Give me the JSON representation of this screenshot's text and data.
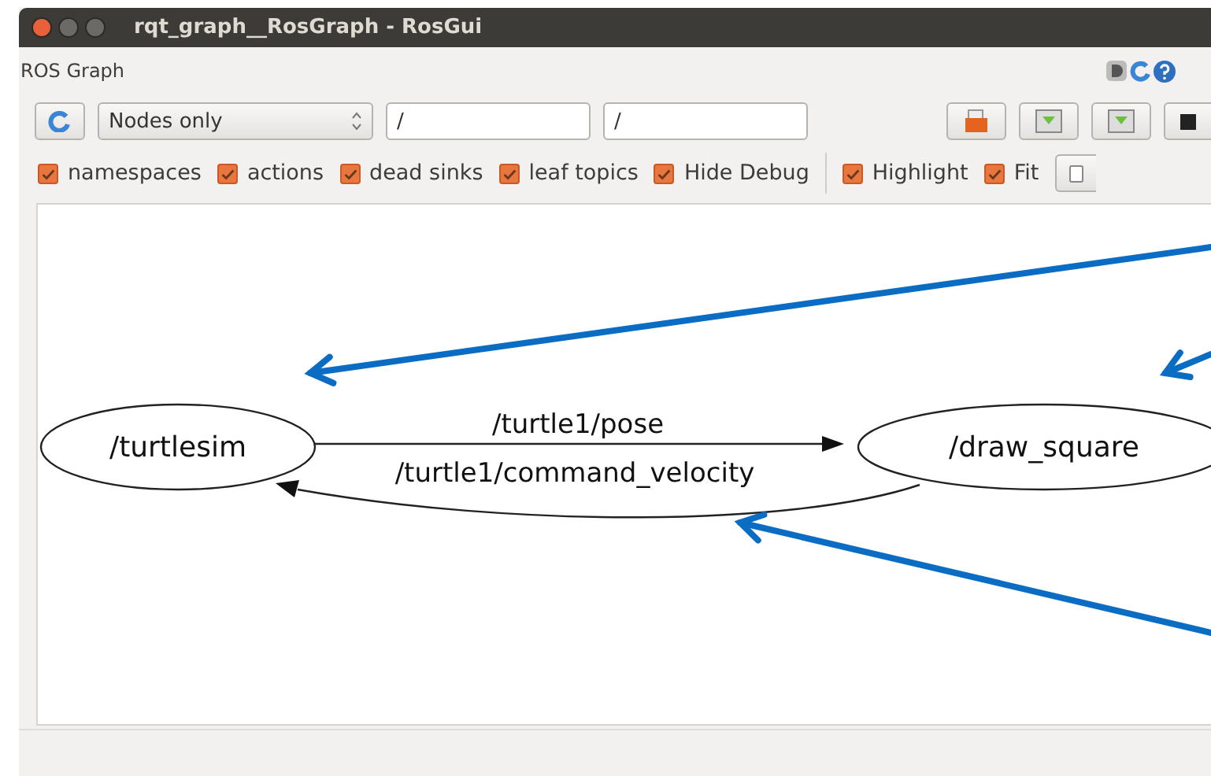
{
  "window": {
    "title": "rqt_graph__RosGraph - RosGui"
  },
  "plugin_title": "ROS Graph",
  "toolbar": {
    "mode": "Nodes only",
    "node_filter": "/",
    "topic_filter": "/"
  },
  "options": [
    {
      "label": "namespaces",
      "checked": true
    },
    {
      "label": "actions",
      "checked": true
    },
    {
      "label": "dead sinks",
      "checked": true
    },
    {
      "label": "leaf topics",
      "checked": true
    },
    {
      "label": "Hide Debug",
      "checked": true
    },
    {
      "label": "Highlight",
      "checked": true
    },
    {
      "label": "Fit",
      "checked": true
    }
  ],
  "graph": {
    "nodes": [
      {
        "label": "/turtlesim"
      },
      {
        "label": "/draw_square"
      }
    ],
    "edges": [
      {
        "label": "/turtle1/pose"
      },
      {
        "label": "/turtle1/command_velocity"
      }
    ]
  }
}
